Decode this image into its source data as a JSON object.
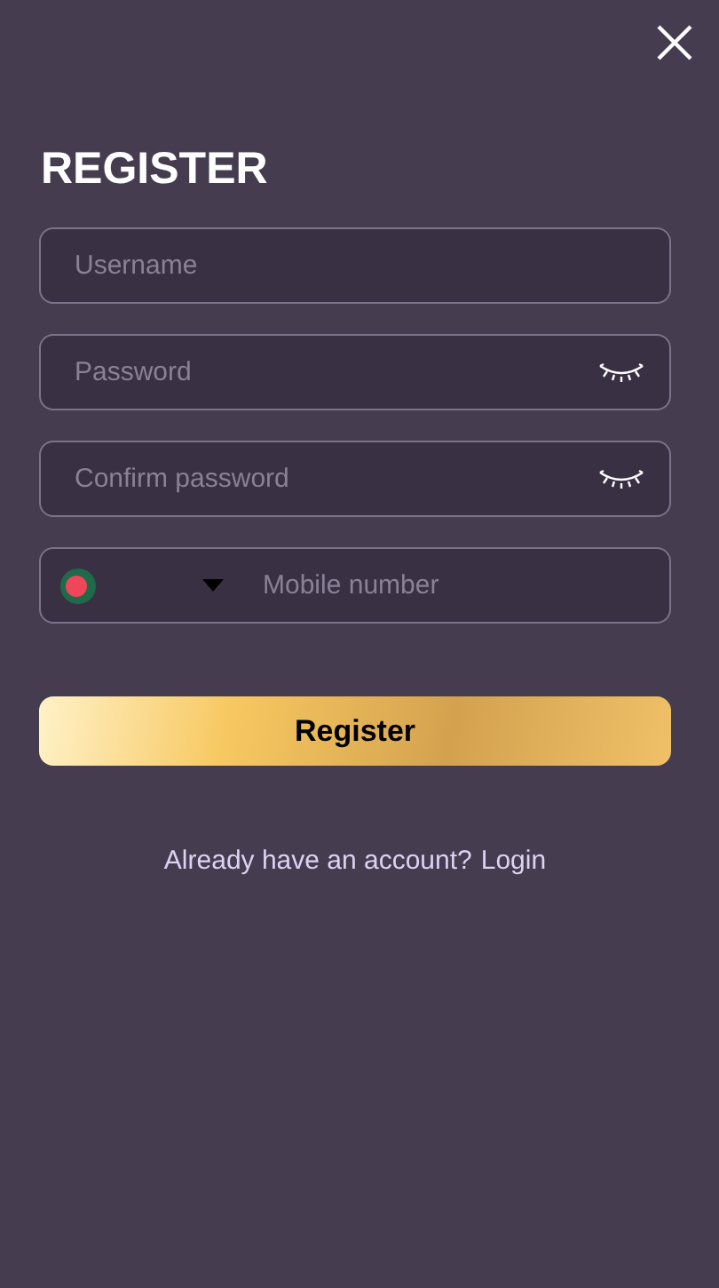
{
  "title": "REGISTER",
  "fields": [
    {
      "kind": "text",
      "placeholder": "Username"
    },
    {
      "kind": "password",
      "placeholder": "Password"
    },
    {
      "kind": "password",
      "placeholder": "Confirm password"
    },
    {
      "kind": "phone",
      "placeholder": "Mobile number"
    }
  ],
  "submit": "Register",
  "footer": {
    "text": "Already have an account?",
    "link": "Login"
  }
}
